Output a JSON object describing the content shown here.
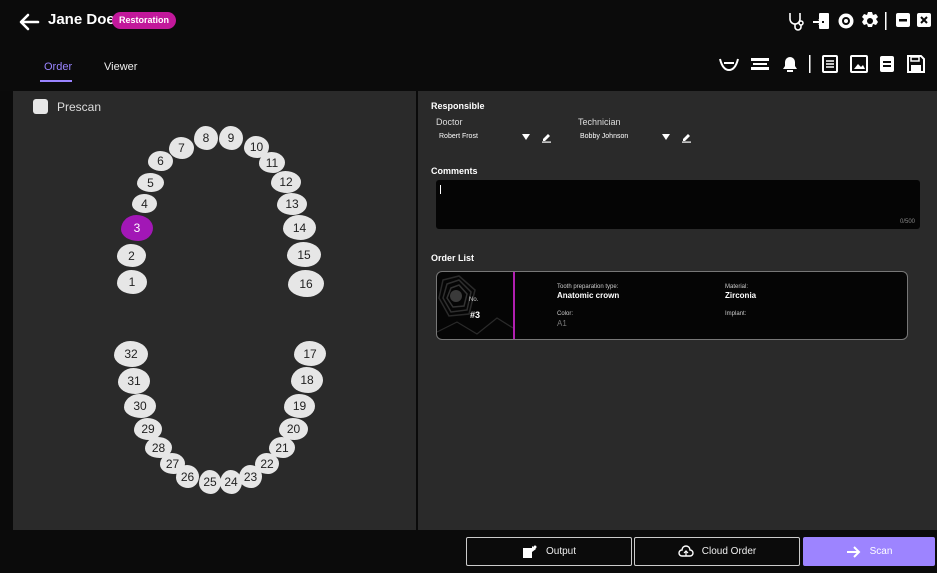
{
  "header": {
    "patient_name": "Jane Doe",
    "badge": "Restoration",
    "icons": [
      "back-arrow-icon",
      "stethoscope-icon",
      "export-icon",
      "settings-cog-icon",
      "gear-icon",
      "minimize-icon",
      "close-icon"
    ]
  },
  "tabs": [
    {
      "label": "Order",
      "active": true
    },
    {
      "label": "Viewer",
      "active": false
    }
  ],
  "toolbar_icons": [
    "lower-jaw-icon",
    "scan-body-icon",
    "bell-icon",
    "notes-icon",
    "image-icon",
    "layers-icon",
    "save-icon"
  ],
  "left": {
    "prescan_label": "Prescan",
    "prescan_checked": false,
    "selected_tooth": "3",
    "upper_teeth": [
      "1",
      "2",
      "3",
      "4",
      "5",
      "6",
      "7",
      "8",
      "9",
      "10",
      "11",
      "12",
      "13",
      "14",
      "15",
      "16"
    ],
    "lower_teeth": [
      "17",
      "18",
      "19",
      "20",
      "21",
      "22",
      "23",
      "24",
      "25",
      "26",
      "27",
      "28",
      "29",
      "30",
      "31",
      "32"
    ]
  },
  "responsible": {
    "title": "Responsible",
    "doctor_label": "Doctor",
    "doctor_value": "Robert Frost",
    "technician_label": "Technician",
    "technician_value": "Bobby Johnson"
  },
  "comments": {
    "title": "Comments",
    "value": "",
    "count": "0/500"
  },
  "order_list": {
    "title": "Order List",
    "item": {
      "no_label": "No.",
      "no_value": "#3",
      "prep_label": "Tooth preparation type:",
      "prep_value": "Anatomic crown",
      "material_label": "Material:",
      "material_value": "Zirconia",
      "color_label": "Color:",
      "color_value": "A1",
      "implant_label": "Implant:",
      "implant_value": ""
    }
  },
  "bottom": {
    "output_label": "Output",
    "cloud_label": "Cloud Order",
    "scan_label": "Scan",
    "accent": "#9d84ff",
    "selected_color": "#a217b6"
  }
}
